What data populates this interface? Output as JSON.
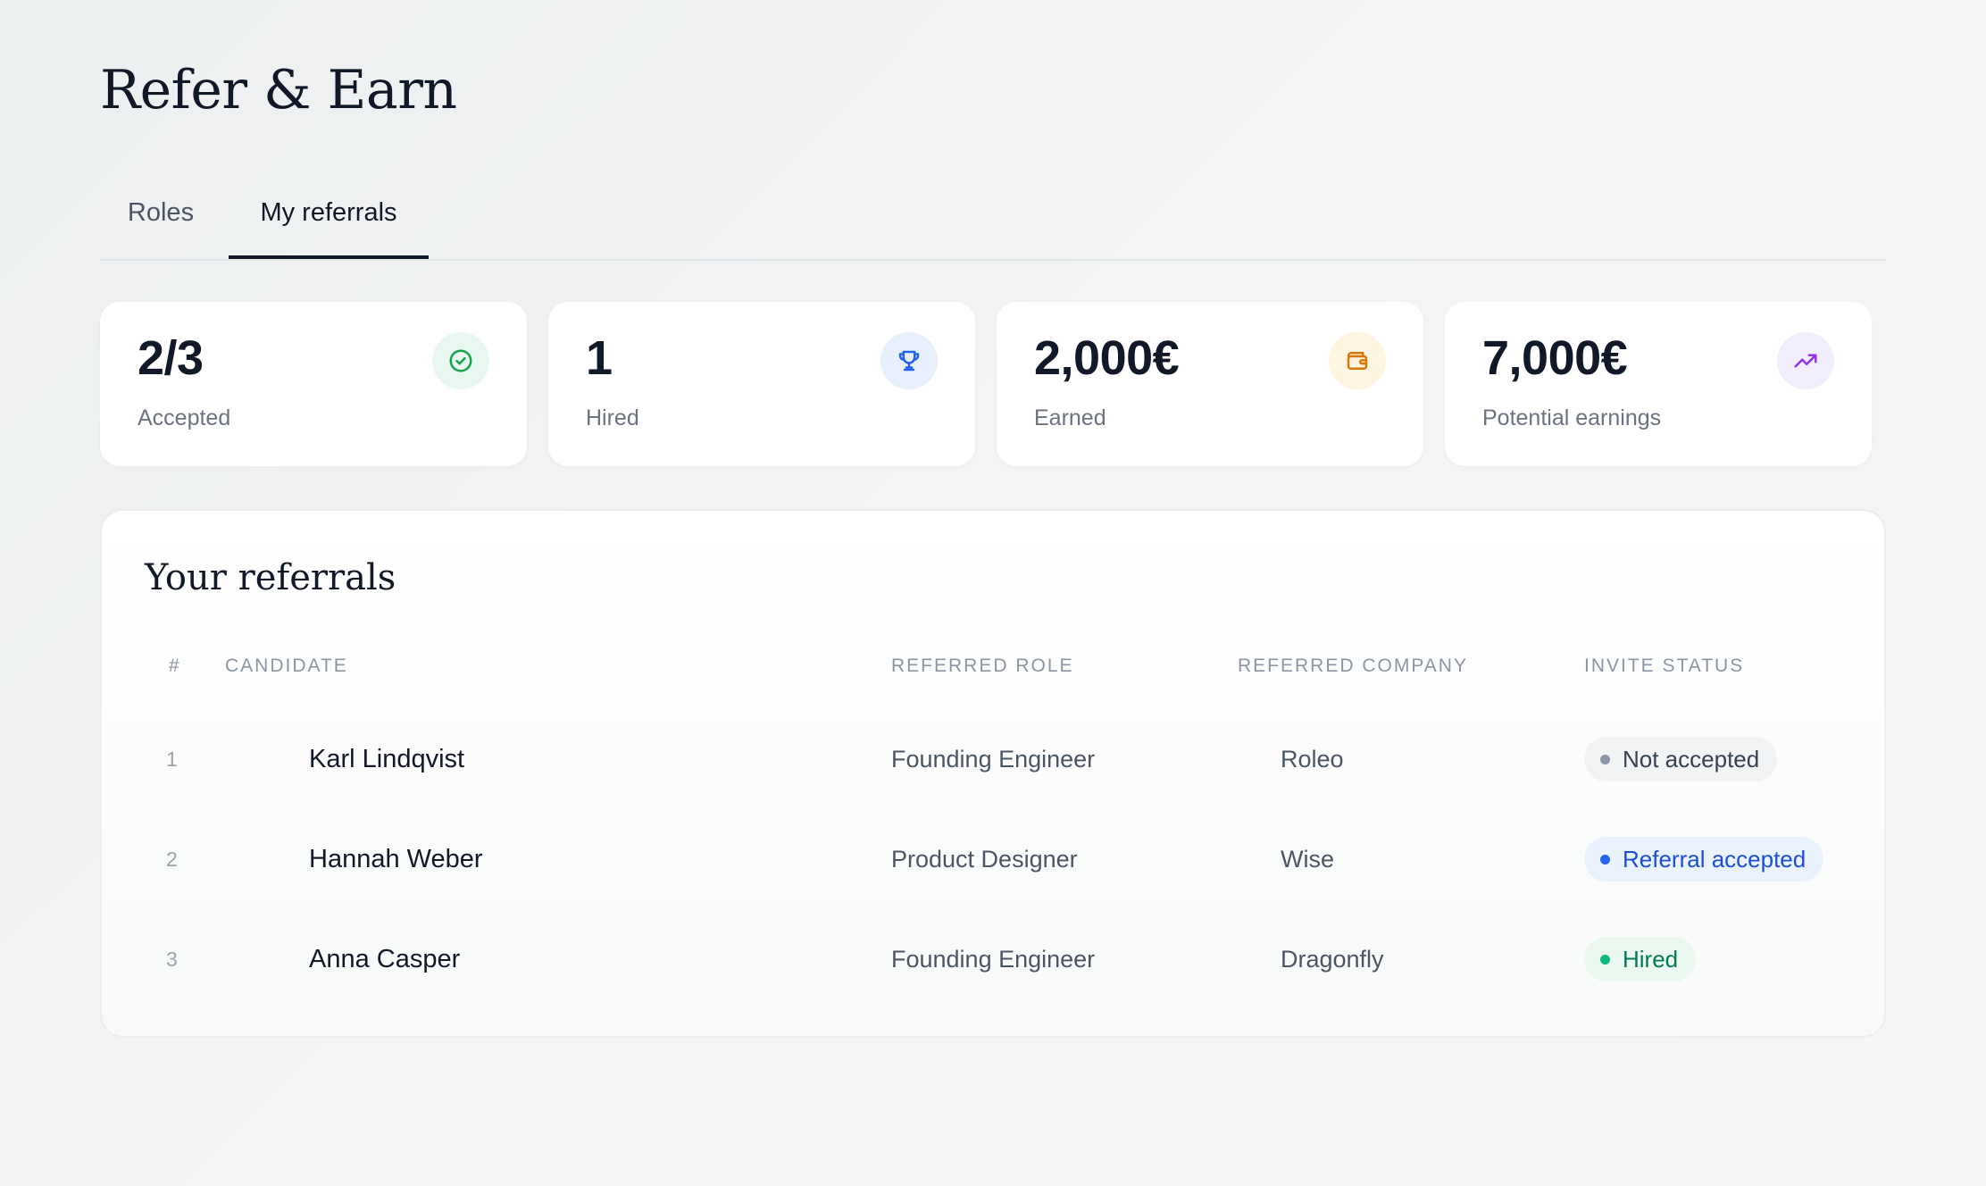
{
  "page": {
    "title": "Refer & Earn"
  },
  "tabs": [
    {
      "label": "Roles",
      "active": false
    },
    {
      "label": "My referrals",
      "active": true
    }
  ],
  "stats": [
    {
      "value": "2/3",
      "label": "Accepted",
      "icon": "check-circle-icon",
      "color": "#16a34a"
    },
    {
      "value": "1",
      "label": "Hired",
      "icon": "trophy-icon",
      "color": "#2563eb"
    },
    {
      "value": "2,000€",
      "label": "Earned",
      "icon": "wallet-icon",
      "color": "#d97706"
    },
    {
      "value": "7,000€",
      "label": "Potential earnings",
      "icon": "trending-up-icon",
      "color": "#9333ea"
    }
  ],
  "referrals": {
    "title": "Your referrals",
    "columns": {
      "num": "#",
      "candidate": "CANDIDATE",
      "role": "REFERRED ROLE",
      "company": "REFERRED COMPANY",
      "status": "INVITE STATUS"
    },
    "rows": [
      {
        "num": "1",
        "candidate": "Karl Lindqvist",
        "role": "Founding Engineer",
        "company": "Roleo",
        "status": "Not accepted",
        "status_color": "gray"
      },
      {
        "num": "2",
        "candidate": "Hannah Weber",
        "role": "Product Designer",
        "company": "Wise",
        "status": "Referral accepted",
        "status_color": "blue"
      },
      {
        "num": "3",
        "candidate": "Anna Casper",
        "role": "Founding Engineer",
        "company": "Dragonfly",
        "status": "Hired",
        "status_color": "green"
      }
    ]
  }
}
